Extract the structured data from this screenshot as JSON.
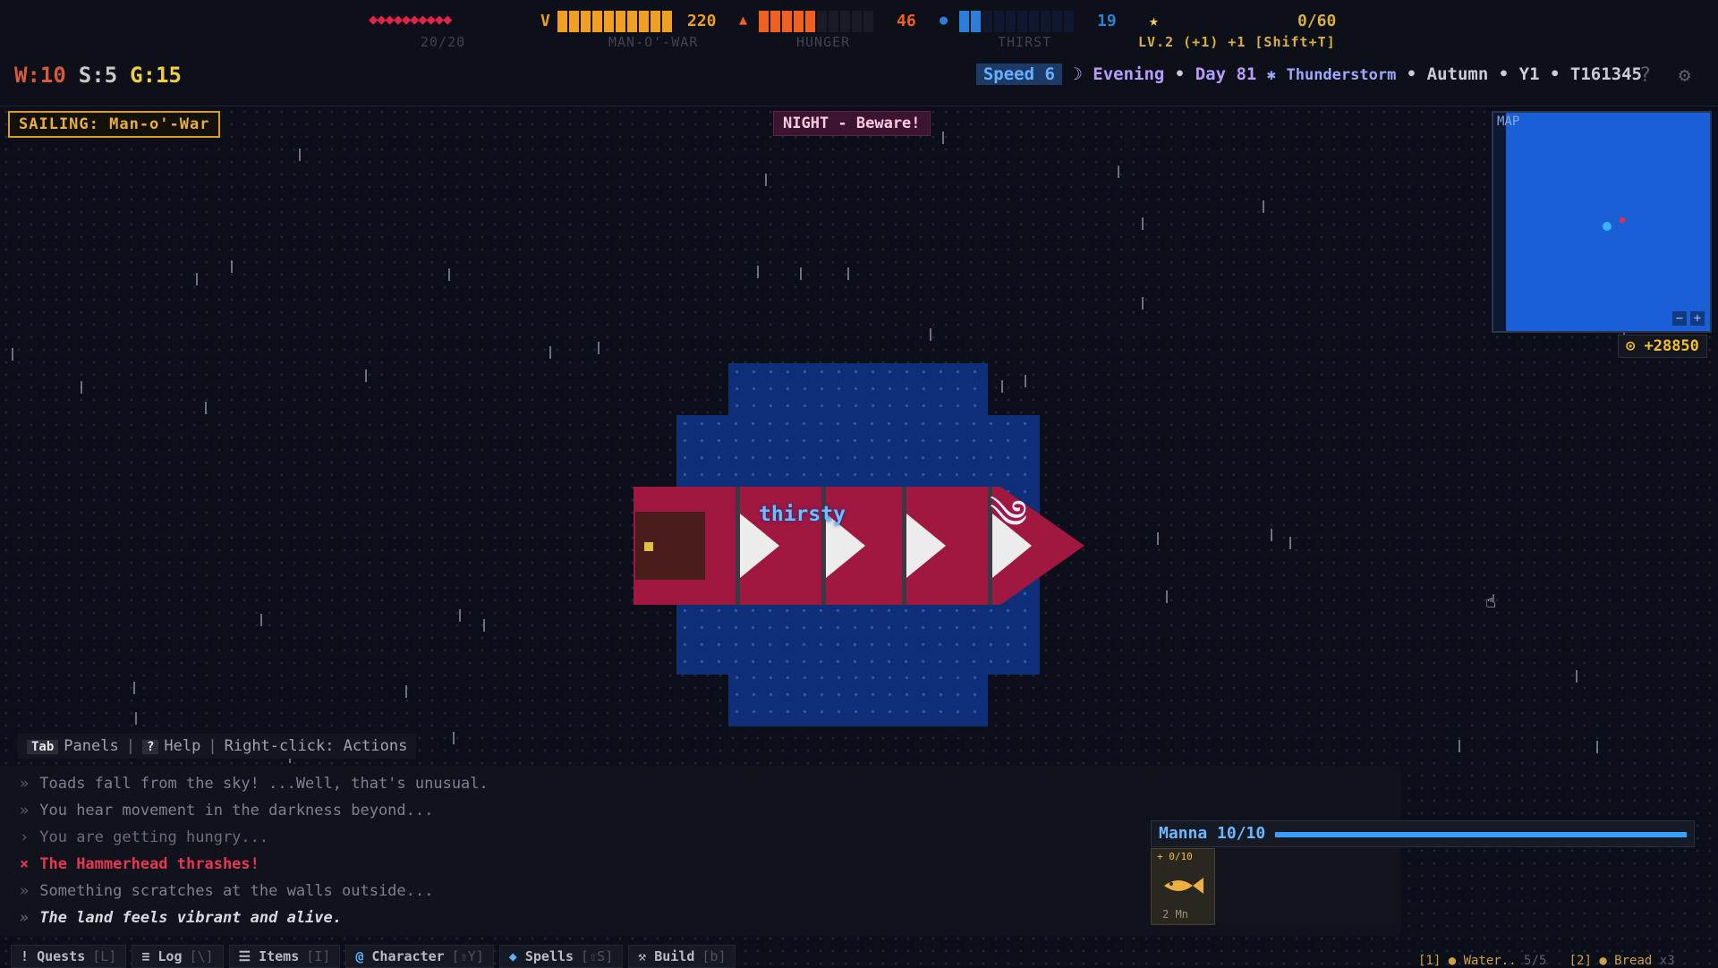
{
  "hud": {
    "health": "20/20",
    "health_label": "20/20",
    "ship_label": "MAN-O'-WAR",
    "ship_value": "220",
    "ship_icon_char": "V",
    "hunger_label": "HUNGER",
    "hunger_value": "46",
    "thirst_label": "THIRST",
    "thirst_value": "19",
    "xp_value": "0/60",
    "level_text": "LV.2 (+1) +1 [Shift+T]",
    "hearts": "◆◆◆◆◆◆◆◆◆◆"
  },
  "resources": {
    "w": "W:10",
    "s": "S:5",
    "g": "G:15"
  },
  "status": {
    "speed": "Speed 6",
    "time": "Evening",
    "day": "Day 81",
    "weather": "Thunderstorm",
    "season": "Autumn",
    "year": "Y1",
    "turn": "T161345",
    "bullet": "•"
  },
  "badges": {
    "sailing": "SAILING: Man-o'-War",
    "night": "NIGHT - Beware!"
  },
  "minimap": {
    "label": "MAP",
    "zoom_out": "−",
    "zoom_in": "+"
  },
  "gold": "+28850",
  "ship": {
    "status_text": "thirsty"
  },
  "hint": {
    "tab_key": "Tab",
    "panels": "Panels",
    "help_key": "?",
    "help": "Help",
    "right_click": "Right-click: Actions",
    "sep": "|"
  },
  "log": [
    {
      "marker": "»",
      "text": "Toads fall from the sky! ...Well, that's unusual."
    },
    {
      "marker": "»",
      "text": "You hear movement in the darkness beyond..."
    },
    {
      "marker": "›",
      "text": "You are getting hungry..."
    },
    {
      "marker": "×",
      "text": "The Hammerhead thrashes!"
    },
    {
      "marker": "»",
      "text": "Something scratches at the walls outside..."
    },
    {
      "marker": "»",
      "text": "The land feels vibrant and alive."
    }
  ],
  "manna": {
    "label": "Manna 10/10",
    "fraction": 1.0,
    "slot_top": "+ 0/10",
    "slot_bottom": "2 Mn"
  },
  "tabs": [
    {
      "label": "Quests",
      "key": "[L]",
      "icon": "!"
    },
    {
      "label": "Log",
      "key": "[\\]",
      "icon": "≡"
    },
    {
      "label": "Items",
      "key": "[I]",
      "icon": "☰"
    },
    {
      "label": "Character",
      "key": "[⇧Y]",
      "icon": "@"
    },
    {
      "label": "Spells",
      "key": "[⇧S]",
      "icon": "◆"
    },
    {
      "label": "Build",
      "key": "[b]",
      "icon": "⚒"
    }
  ],
  "hotbar": {
    "slot1": "[1] ● Water..",
    "slot1_count": "5/5",
    "slot2": "[2] ● Bread",
    "slot2_count": "x3"
  },
  "colors": {
    "ocean": "#0c0f1a",
    "hull": "#a01840",
    "health": "#e0244a",
    "ship_bar": "#f0a020",
    "hunger": "#f06020",
    "thirst": "#2a80d8",
    "minimap": "#1a5fd6"
  }
}
